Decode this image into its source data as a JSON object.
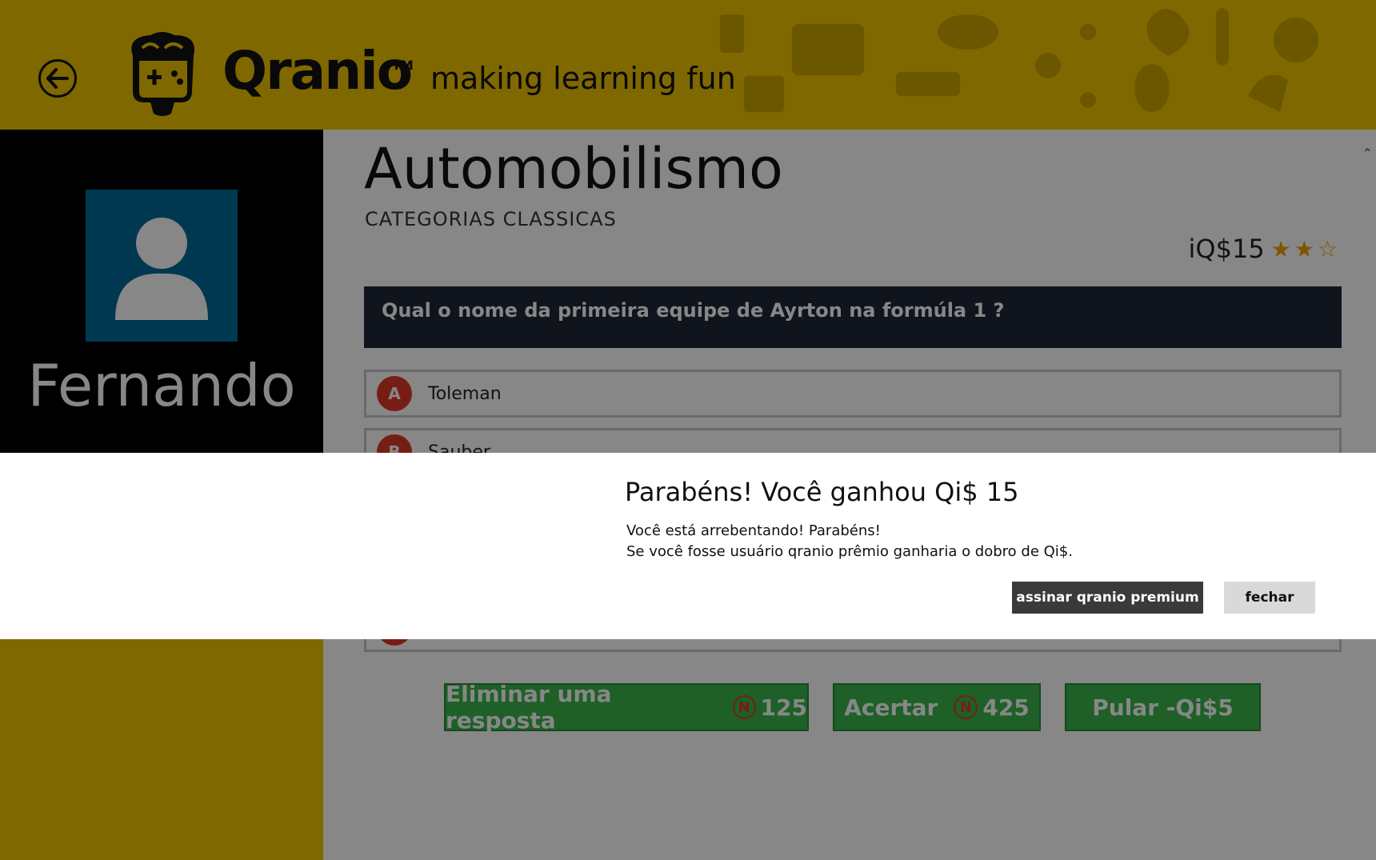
{
  "header": {
    "logo_text": "Qranio",
    "trademark": "TM",
    "tagline": "making learning fun",
    "background_color": "#f2c500"
  },
  "sidebar": {
    "user_name": "Fernando",
    "avatar_color": "#006a9a"
  },
  "category": {
    "title": "Automobilismo",
    "subtitle": "CATEGORIAS CLASSICAS",
    "reward": "iQ$15",
    "stars_filled": 2,
    "stars_total": 3
  },
  "question": {
    "text": "Qual o nome da primeira equipe de Ayrton na formúla 1 ?",
    "options": [
      {
        "letter": "A",
        "text": "Toleman"
      },
      {
        "letter": "B",
        "text": "Sauber"
      }
    ]
  },
  "actions": {
    "eliminate_label": "Eliminar uma resposta",
    "eliminate_cost": "125",
    "correct_label": "Acertar",
    "correct_cost": "425",
    "skip_label": "Pular -Qi$5",
    "coin_symbol": "N"
  },
  "dialog": {
    "title": "Parabéns! Você ganhou Qi$ 15",
    "line1": "Você está arrebentando! Parabéns!",
    "line2": "Se você fosse usuário qranio prêmio ganharia o dobro de Qi$.",
    "premium_button": "assinar qranio premium",
    "close_button": "fechar"
  }
}
